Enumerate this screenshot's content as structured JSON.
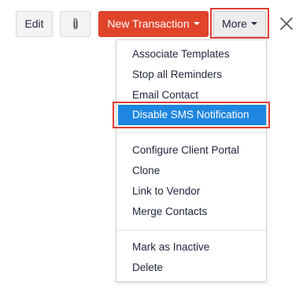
{
  "toolbar": {
    "edit_label": "Edit",
    "attach_icon": "paperclip-icon",
    "new_transaction_label": "New Transaction",
    "more_label": "More",
    "close_icon": "close-icon"
  },
  "menu": {
    "items": [
      "Associate Templates",
      "Stop all Reminders",
      "Email Contact",
      "Disable SMS Notification",
      "Configure Client Portal",
      "Clone",
      "Link to Vendor",
      "Merge Contacts",
      "Mark as Inactive",
      "Delete"
    ],
    "highlighted_item": "Disable SMS Notification"
  },
  "colors": {
    "primary_button": "#e0452c",
    "highlight": "#1f86e0",
    "annotation_outline": "#e03d35"
  }
}
